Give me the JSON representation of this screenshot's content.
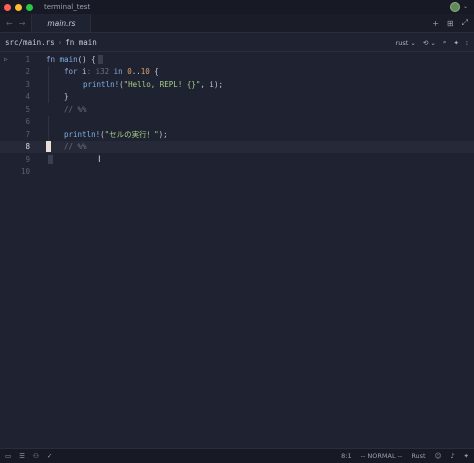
{
  "window": {
    "title": "terminal_test"
  },
  "tabs": [
    {
      "label": "main.rs"
    }
  ],
  "nav": {
    "back": "←",
    "forward": "→"
  },
  "tab_actions": {
    "add": "+",
    "split": "⊞",
    "expand": "⤢"
  },
  "breadcrumb": {
    "file": "src/main.rs",
    "separator": "›",
    "symbol": "fn main"
  },
  "toolbar": {
    "language": "rust ⌄",
    "run": "⟲ ⌄",
    "search": "⌕",
    "magic": "✦",
    "more": "⁝"
  },
  "editor": {
    "lines": [
      {
        "num": "1"
      },
      {
        "num": "2"
      },
      {
        "num": "3"
      },
      {
        "num": "4"
      },
      {
        "num": "5"
      },
      {
        "num": "6"
      },
      {
        "num": "7"
      },
      {
        "num": "8"
      },
      {
        "num": "9"
      },
      {
        "num": "10"
      }
    ],
    "gutter_run": "▷",
    "tokens": {
      "l1_fn": "fn",
      "l1_name": " main",
      "l1_rest": "() {",
      "l2_for": "for",
      "l2_i": " i",
      "l2_hint": ": i32",
      "l2_in": " in",
      "l2_range_a": " 0",
      "l2_dots": "..",
      "l2_range_b": "10",
      "l2_brace": " {",
      "l3_mac": "println!",
      "l3_open": "(",
      "l3_str": "\"Hello, REPL! {}\"",
      "l3_rest": ", i);",
      "l4": "}",
      "l5": "// %%",
      "l7_mac": "println!",
      "l7_open": "(",
      "l7_str": "\"セルの実行！\"",
      "l7_rest": ");",
      "l8": "// %%"
    }
  },
  "status": {
    "position": "8:1",
    "mode": "-- NORMAL --",
    "language": "Rust"
  }
}
